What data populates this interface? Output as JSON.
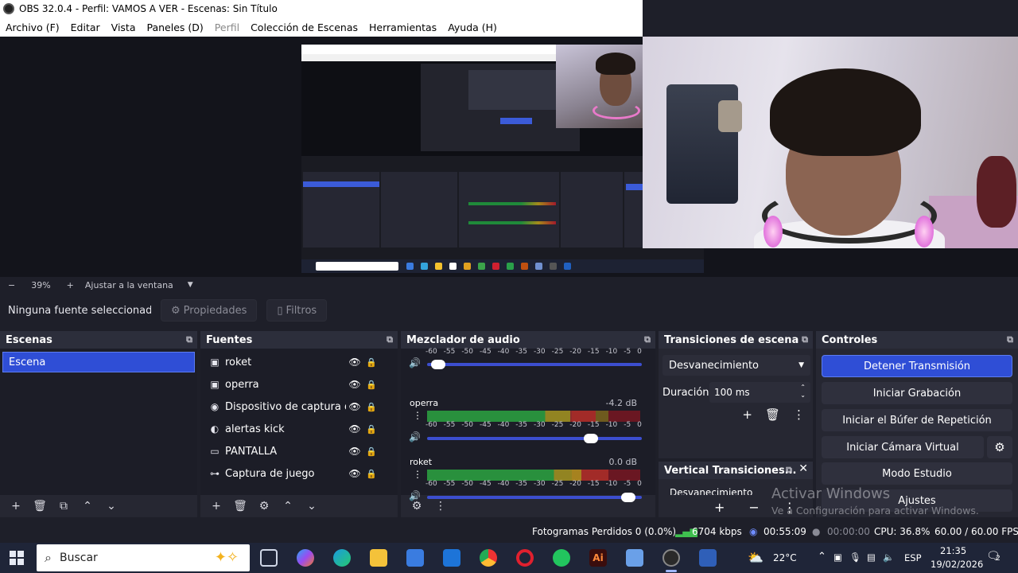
{
  "window": {
    "title": "OBS 32.0.4 - Perfil: VAMOS A VER - Escenas: Sin Título"
  },
  "menu": [
    "Archivo (F)",
    "Editar",
    "Vista",
    "Paneles (D)",
    "Perfil",
    "Colección de Escenas",
    "Herramientas",
    "Ayuda (H)"
  ],
  "zoom": {
    "minus": "−",
    "value": "39%",
    "plus": "+",
    "fit_label": "Ajustar a la ventana"
  },
  "source_toolbar": {
    "no_selection": "Ninguna fuente seleccionada",
    "properties": "Propiedades",
    "filters": "Filtros"
  },
  "scenes": {
    "title": "Escenas",
    "items": [
      "Escena"
    ]
  },
  "sources": {
    "title": "Fuentes",
    "items": [
      {
        "name": "roket",
        "icon": "browser-icon"
      },
      {
        "name": "operra",
        "icon": "browser-icon"
      },
      {
        "name": "Dispositivo de captura de video",
        "icon": "camera-icon"
      },
      {
        "name": "alertas kick",
        "icon": "globe-icon"
      },
      {
        "name": "PANTALLA",
        "icon": "monitor-icon"
      },
      {
        "name": "Captura de juego",
        "icon": "gamepad-icon"
      }
    ]
  },
  "mixer": {
    "title": "Mezclador de audio",
    "scale": [
      "-60",
      "-55",
      "-50",
      "-45",
      "-40",
      "-35",
      "-30",
      "-25",
      "-20",
      "-15",
      "-10",
      "-5",
      "0"
    ],
    "channels": [
      {
        "name": "",
        "db": "",
        "level": 0.0,
        "volume": 0.02
      },
      {
        "name": "operra",
        "db": "-4.2 dB",
        "level": 0.79,
        "volume": 0.78
      },
      {
        "name": "roket",
        "db": "0.0 dB",
        "level": 0.85,
        "volume": 0.97
      }
    ]
  },
  "transitions": {
    "title": "Transiciones de escena",
    "selected": "Desvanecimiento",
    "duration_label": "Duración",
    "duration_value": "100 ms",
    "vertical_title": "Vertical Transiciones...",
    "vertical_selected": "Desvanecimiento"
  },
  "controls": {
    "title": "Controles",
    "buttons": [
      "Detener Transmisión",
      "Iniciar Grabación",
      "Iniciar el Búfer de Repetición",
      "Iniciar Cámara Virtual",
      "Modo Estudio",
      "Ajustes"
    ]
  },
  "status": {
    "dropped_frames": "Fotogramas Perdidos 0 (0.0%)",
    "bitrate": "6704 kbps",
    "stream_time": "00:55:09",
    "rec_time": "00:00:00",
    "cpu": "CPU: 36.8%",
    "fps": "60.00 / 60.00 FPS"
  },
  "watermark": {
    "line1": "Activar Windows",
    "line2": "Ve a Configuración para activar Windows."
  },
  "taskbar": {
    "search_placeholder": "Buscar",
    "weather": "22°C",
    "language": "ESP",
    "time": "21:35",
    "date": "19/02/2026",
    "notifications": "2"
  },
  "colors": {
    "accent": "#2f4ed6",
    "dock_bg": "#262732",
    "panel_bg": "#1c1d27"
  }
}
